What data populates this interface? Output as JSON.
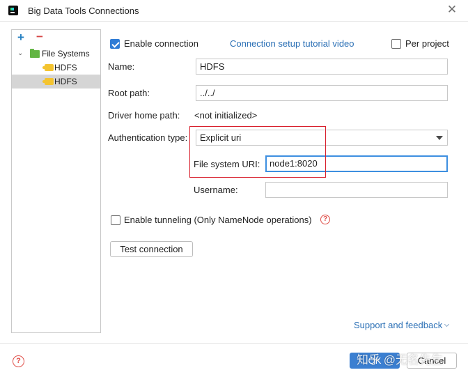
{
  "window": {
    "title": "Big Data Tools Connections"
  },
  "toolbar": {
    "add": "+",
    "remove": "−"
  },
  "tree": {
    "root": "File Systems",
    "children": [
      {
        "label": "HDFS"
      },
      {
        "label": "HDFS",
        "selected": true
      }
    ]
  },
  "form": {
    "enable_connection": {
      "label": "Enable connection",
      "checked": true
    },
    "tutorial_link": "Connection setup tutorial video",
    "per_project": {
      "label": "Per project",
      "checked": false
    },
    "name": {
      "label": "Name:",
      "value": "HDFS"
    },
    "root_path": {
      "label": "Root path:",
      "value": "../../"
    },
    "driver_home": {
      "label": "Driver home path:",
      "value": "<not initialized>"
    },
    "auth_type": {
      "label": "Authentication type:",
      "value": "Explicit uri"
    },
    "fs_uri": {
      "label": "File system URI:",
      "value": "node1:8020"
    },
    "username": {
      "label": "Username:",
      "value": ""
    },
    "tunneling": {
      "label": "Enable tunneling (Only NameNode operations)",
      "checked": false
    },
    "help_glyph": "?",
    "test_button": "Test connection"
  },
  "footer": {
    "support_link": "Support and feedback",
    "help_glyph": "?",
    "ok_label": "OK",
    "cancel_label": "Cancel",
    "watermark": "知乎 @无名先生"
  },
  "colors": {
    "accent": "#3b7fd1",
    "link": "#2a6fb5",
    "highlight": "#d8202d",
    "tree_selected": "#d5d5d5"
  }
}
